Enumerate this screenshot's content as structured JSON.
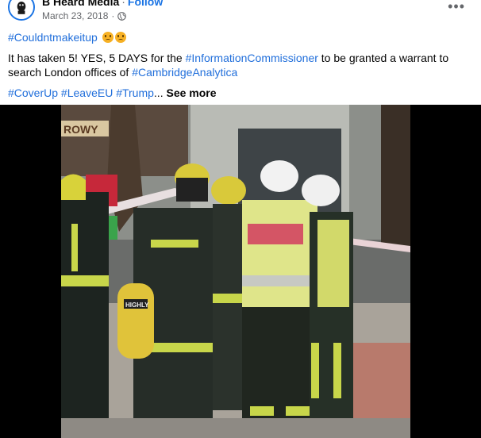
{
  "post": {
    "page_name": "B Heard Media",
    "separator": "·",
    "follow_label": "Follow",
    "date": "March 23, 2018",
    "meta_separator": "·",
    "privacy_icon": "globe-icon",
    "more_label": "•••",
    "hashtag_line": "#Couldntmakeitup",
    "emoji": [
      "angry-face",
      "angry-face"
    ],
    "body_part1": "It has taken 5! YES, 5 DAYS for the ",
    "body_hashtag1": "#InformationCommissioner",
    "body_part2": " to be granted a warrant to search London offices of ",
    "body_hashtag2": "#CambridgeAnalytica",
    "tags": [
      "#CoverUp",
      "#LeaveEU",
      "#Trump"
    ],
    "ellipsis": "...",
    "see_more_label": "See more"
  },
  "video": {
    "description_icon": "video-player",
    "sign_text": "ROWY",
    "vest_text": "HIGHLY"
  },
  "colors": {
    "link": "#216fdb",
    "follow": "#1b74e4",
    "secondary_text": "#65676b",
    "hi_vis_yellow": "#c8d64a"
  }
}
